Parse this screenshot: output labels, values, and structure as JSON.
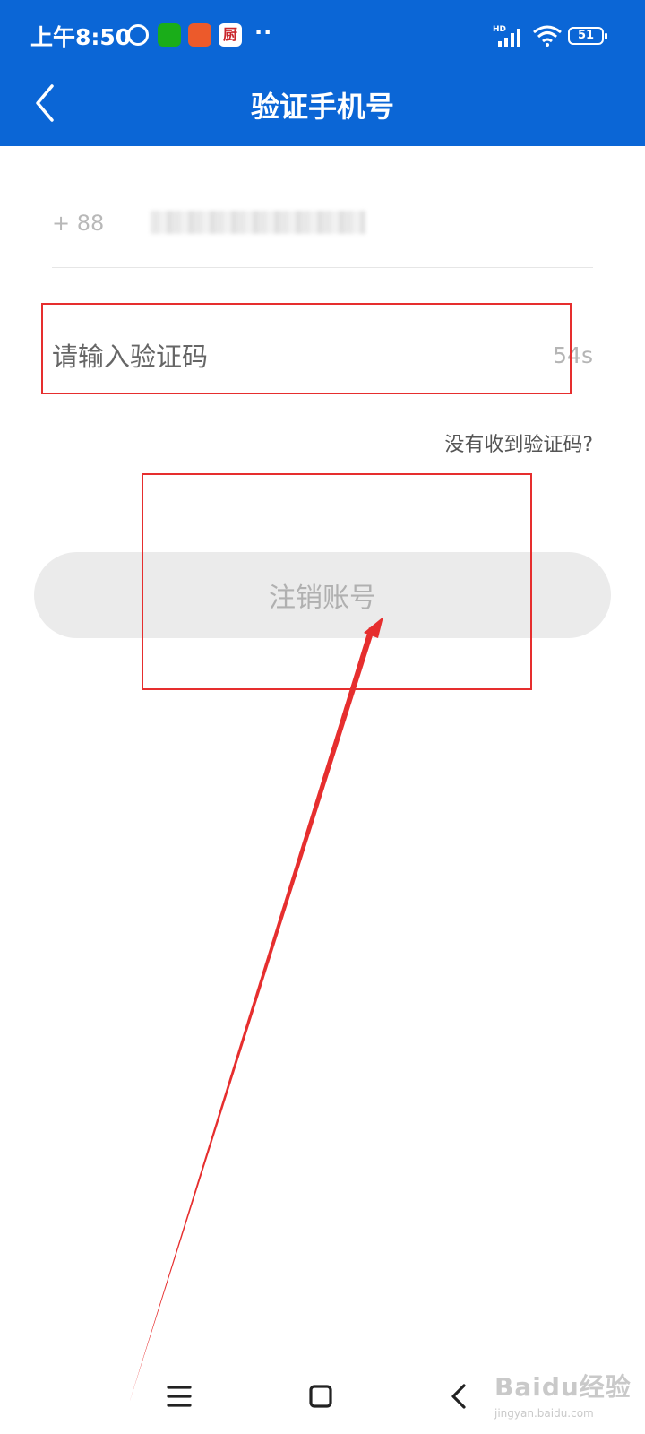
{
  "status_bar": {
    "time": "上午8:50",
    "app3_label": "厨",
    "network": "HD",
    "battery": "51",
    "overflow": "··"
  },
  "header": {
    "title": "验证手机号"
  },
  "phone": {
    "prefix": "+ 88"
  },
  "verification": {
    "placeholder": "请输入验证码",
    "countdown": "54s",
    "resend_link": "没有收到验证码?"
  },
  "action": {
    "cancel_account_label": "注销账号"
  },
  "colors": {
    "brand_blue": "#0b66d6",
    "annotation_red": "#e62e2e"
  },
  "icons": {
    "back": "back-chevron-icon",
    "alarm": "alarm-icon",
    "wechat": "wechat-icon",
    "signal": "signal-icon",
    "wifi": "wifi-icon",
    "battery": "battery-icon",
    "nav_menu": "menu-icon",
    "nav_home": "home-icon",
    "nav_back": "back-icon"
  },
  "watermark": {
    "main": "Baidu经验",
    "sub": "jingyan.baidu.com"
  }
}
